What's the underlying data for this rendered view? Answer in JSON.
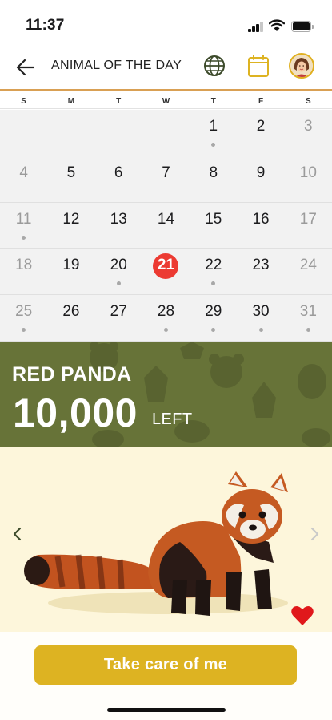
{
  "status_bar": {
    "time": "11:37"
  },
  "header": {
    "title": "ANIMAL OF THE DAY"
  },
  "icons": {
    "back": "arrow-left-icon",
    "globe": "globe-icon",
    "calendar": "calendar-icon",
    "avatar": "avatar",
    "prev": "chevron-left-icon",
    "next": "chevron-right-icon",
    "heart": "heart-icon"
  },
  "colors": {
    "accent": "#ddb322",
    "banner": "#677338",
    "today": "#ec3a32",
    "photo_bg": "#fdf6db"
  },
  "calendar": {
    "weekdays": [
      "S",
      "M",
      "T",
      "W",
      "T",
      "F",
      "S"
    ],
    "weeks": [
      [
        {
          "day": ""
        },
        {
          "day": ""
        },
        {
          "day": ""
        },
        {
          "day": ""
        },
        {
          "day": "1",
          "dot": true
        },
        {
          "day": "2"
        },
        {
          "day": "3",
          "muted": true
        }
      ],
      [
        {
          "day": "4",
          "muted": true
        },
        {
          "day": "5"
        },
        {
          "day": "6"
        },
        {
          "day": "7"
        },
        {
          "day": "8"
        },
        {
          "day": "9"
        },
        {
          "day": "10",
          "muted": true
        }
      ],
      [
        {
          "day": "11",
          "muted": true,
          "dot": true
        },
        {
          "day": "12"
        },
        {
          "day": "13"
        },
        {
          "day": "14"
        },
        {
          "day": "15"
        },
        {
          "day": "16"
        },
        {
          "day": "17",
          "muted": true
        }
      ],
      [
        {
          "day": "18",
          "muted": true
        },
        {
          "day": "19"
        },
        {
          "day": "20",
          "dot": true
        },
        {
          "day": "21",
          "today": true
        },
        {
          "day": "22",
          "dot": true
        },
        {
          "day": "23"
        },
        {
          "day": "24",
          "muted": true
        }
      ],
      [
        {
          "day": "25",
          "muted": true,
          "dot": true
        },
        {
          "day": "26"
        },
        {
          "day": "27"
        },
        {
          "day": "28",
          "dot": true
        },
        {
          "day": "29",
          "dot": true
        },
        {
          "day": "30",
          "dot": true
        },
        {
          "day": "31",
          "muted": true,
          "dot": true
        }
      ]
    ]
  },
  "banner": {
    "animal_name": "RED PANDA",
    "count": "10,000",
    "count_suffix": "LEFT"
  },
  "actions": {
    "cta_label": "Take care of me"
  }
}
